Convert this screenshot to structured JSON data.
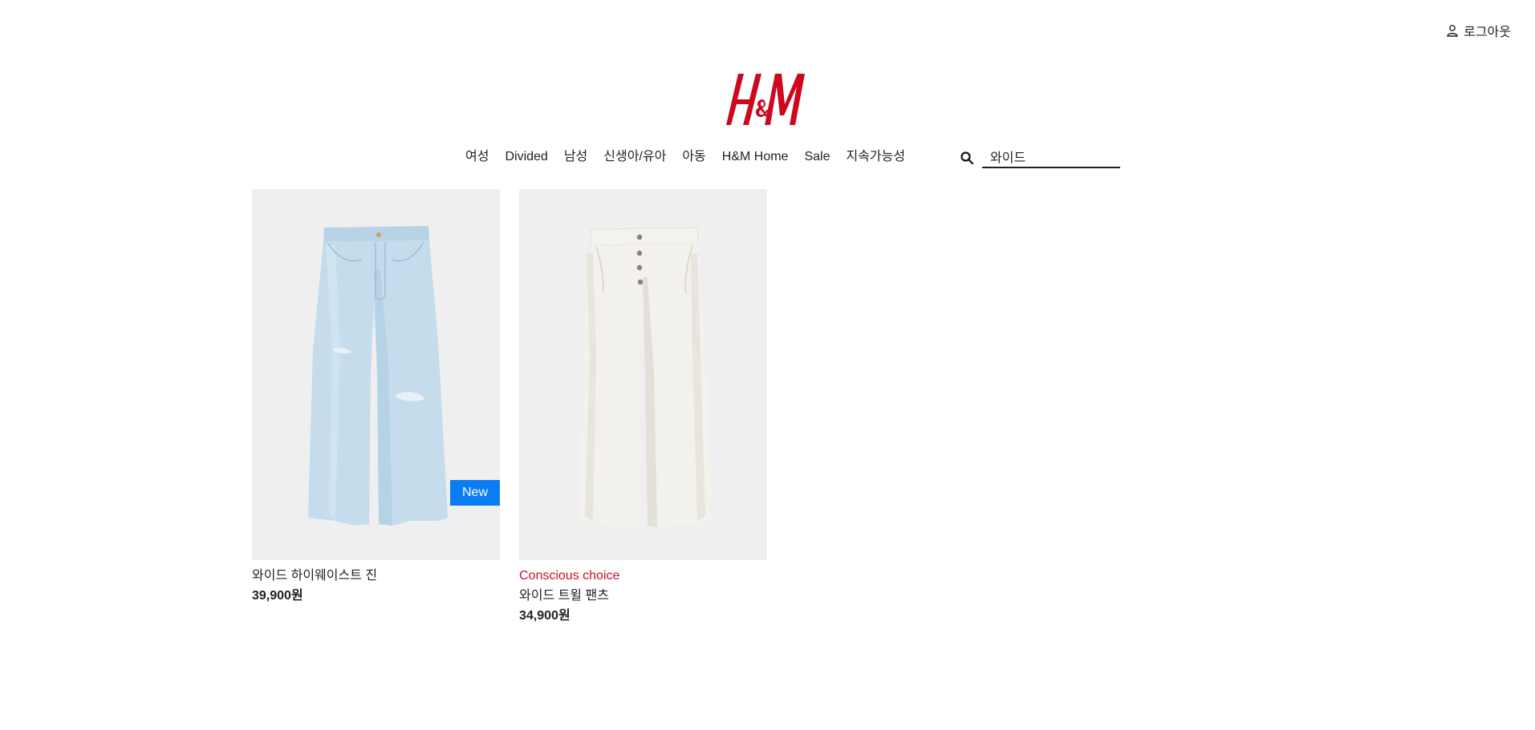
{
  "account": {
    "icon": "user-icon",
    "label": "로그아웃"
  },
  "logo": {
    "text": "H&M",
    "color": "#cc071e"
  },
  "nav": {
    "items": [
      {
        "label": "여성"
      },
      {
        "label": "Divided"
      },
      {
        "label": "남성"
      },
      {
        "label": "신생아/유아"
      },
      {
        "label": "아동"
      },
      {
        "label": "H&M Home"
      },
      {
        "label": "Sale"
      },
      {
        "label": "지속가능성"
      }
    ]
  },
  "search": {
    "icon": "search-icon",
    "value": "와이드"
  },
  "products": [
    {
      "image_desc_icon": "light-blue-wide-jeans-image",
      "badge": "New",
      "badge_color": "#0a7df5",
      "name": "와이드 하이웨이스트 진",
      "price": "39,900원"
    },
    {
      "image_desc_icon": "white-twill-pants-image",
      "tag": "Conscious choice",
      "tag_color": "#c8102e",
      "name": "와이드 트윌 팬츠",
      "price": "34,900원"
    }
  ]
}
